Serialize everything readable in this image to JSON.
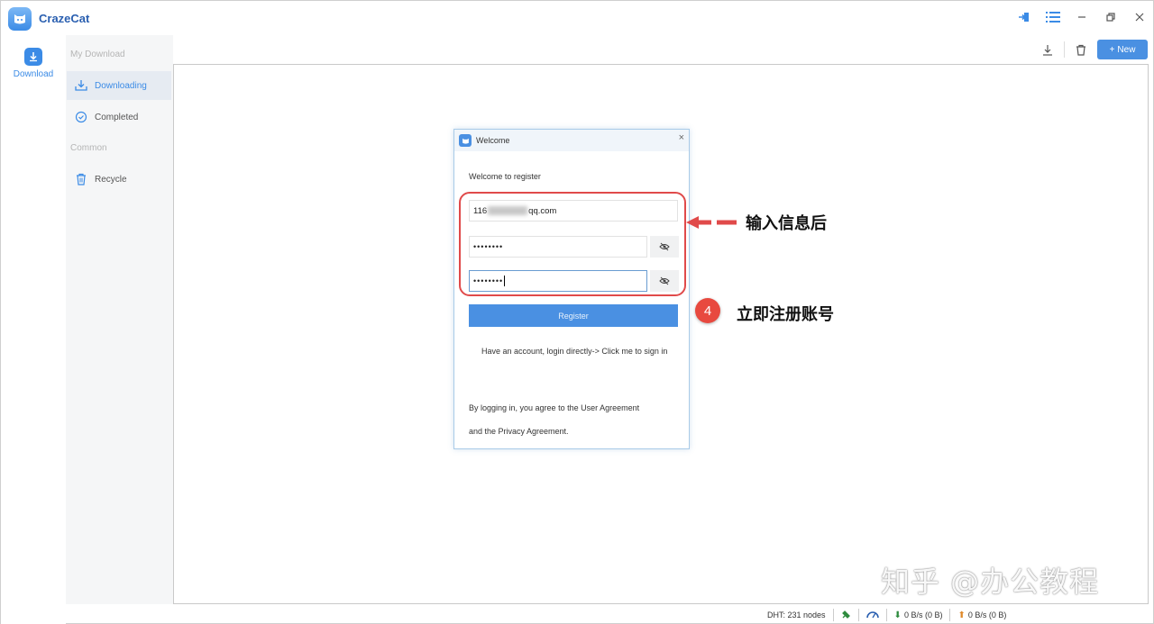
{
  "app": {
    "name": "CrazeCat"
  },
  "rail": {
    "download_label": "Download"
  },
  "sidebar": {
    "section_my_download": "My Download",
    "items": [
      {
        "label": "Downloading"
      },
      {
        "label": "Completed"
      }
    ],
    "section_common": "Common",
    "recycle_label": "Recycle"
  },
  "toolbar": {
    "new_label": "New"
  },
  "dialog": {
    "title": "Welcome",
    "subtitle": "Welcome to register",
    "email_prefix": "116",
    "email_suffix": "qq.com",
    "password_mask": "••••••••",
    "confirm_mask": "••••••••",
    "register_label": "Register",
    "login_text": "Have an account, login directly-> Click me to sign in",
    "agree_line1": "By logging in, you agree to the User Agreement",
    "agree_line2": "and the Privacy Agreement."
  },
  "annotations": {
    "input_note": "输入信息后",
    "step_number": "4",
    "register_note": "立即注册账号",
    "watermark": "知乎 @办公教程"
  },
  "status": {
    "dht": "DHT: 231 nodes",
    "download_speed": "0 B/s (0 B)",
    "upload_speed": "0 B/s (0 B)"
  },
  "colors": {
    "accent": "#4a90e2",
    "annotation_red": "#e04a4a"
  }
}
